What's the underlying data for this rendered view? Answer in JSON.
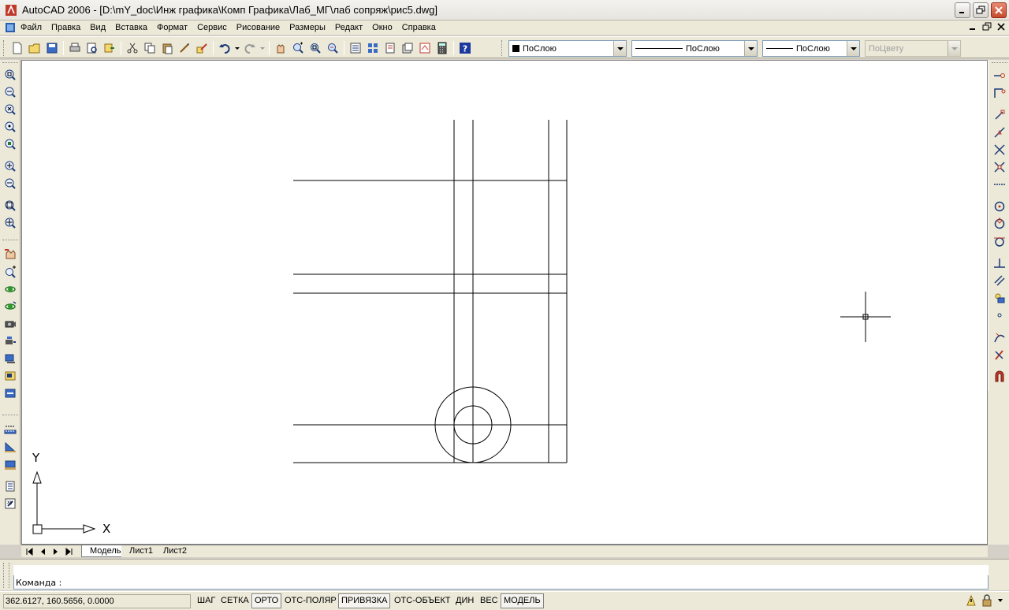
{
  "window": {
    "title": "AutoCAD 2006 - [D:\\mY_doc\\Инж графика\\Комп Графика\\Лаб_МГ\\лаб сопряж\\рис5.dwg]"
  },
  "menu": {
    "items": [
      "Файл",
      "Правка",
      "Вид",
      "Вставка",
      "Формат",
      "Сервис",
      "Рисование",
      "Размеры",
      "Редакт",
      "Окно",
      "Справка"
    ]
  },
  "properties": {
    "color": "ПоСлою",
    "linetype": "ПоСлою",
    "lineweight": "ПоСлою",
    "plotstyle": "ПоЦвету"
  },
  "ucs": {
    "x_label": "X",
    "y_label": "Y"
  },
  "tabs": {
    "items": [
      {
        "label": "Модель",
        "active": true
      },
      {
        "label": "Лист1",
        "active": false
      },
      {
        "label": "Лист2",
        "active": false
      }
    ]
  },
  "command": {
    "prompt": "Команда :"
  },
  "status": {
    "coordinates": "362.6127, 160.5656, 0.0000",
    "toggles": [
      {
        "label": "ШАГ",
        "on": false
      },
      {
        "label": "СЕТКА",
        "on": false
      },
      {
        "label": "ОРТО",
        "on": true
      },
      {
        "label": "ОТС-ПОЛЯР",
        "on": false
      },
      {
        "label": "ПРИВЯЗКА",
        "on": true
      },
      {
        "label": "ОТС-ОБЪЕКТ",
        "on": false
      },
      {
        "label": "ДИН",
        "on": false
      },
      {
        "label": "ВЕС",
        "on": false
      },
      {
        "label": "МОДЕЛЬ",
        "on": true
      }
    ]
  },
  "colors": {
    "canvas": "#ffffff",
    "chrome": "#ece9d8",
    "drawing_line": "#000000"
  }
}
